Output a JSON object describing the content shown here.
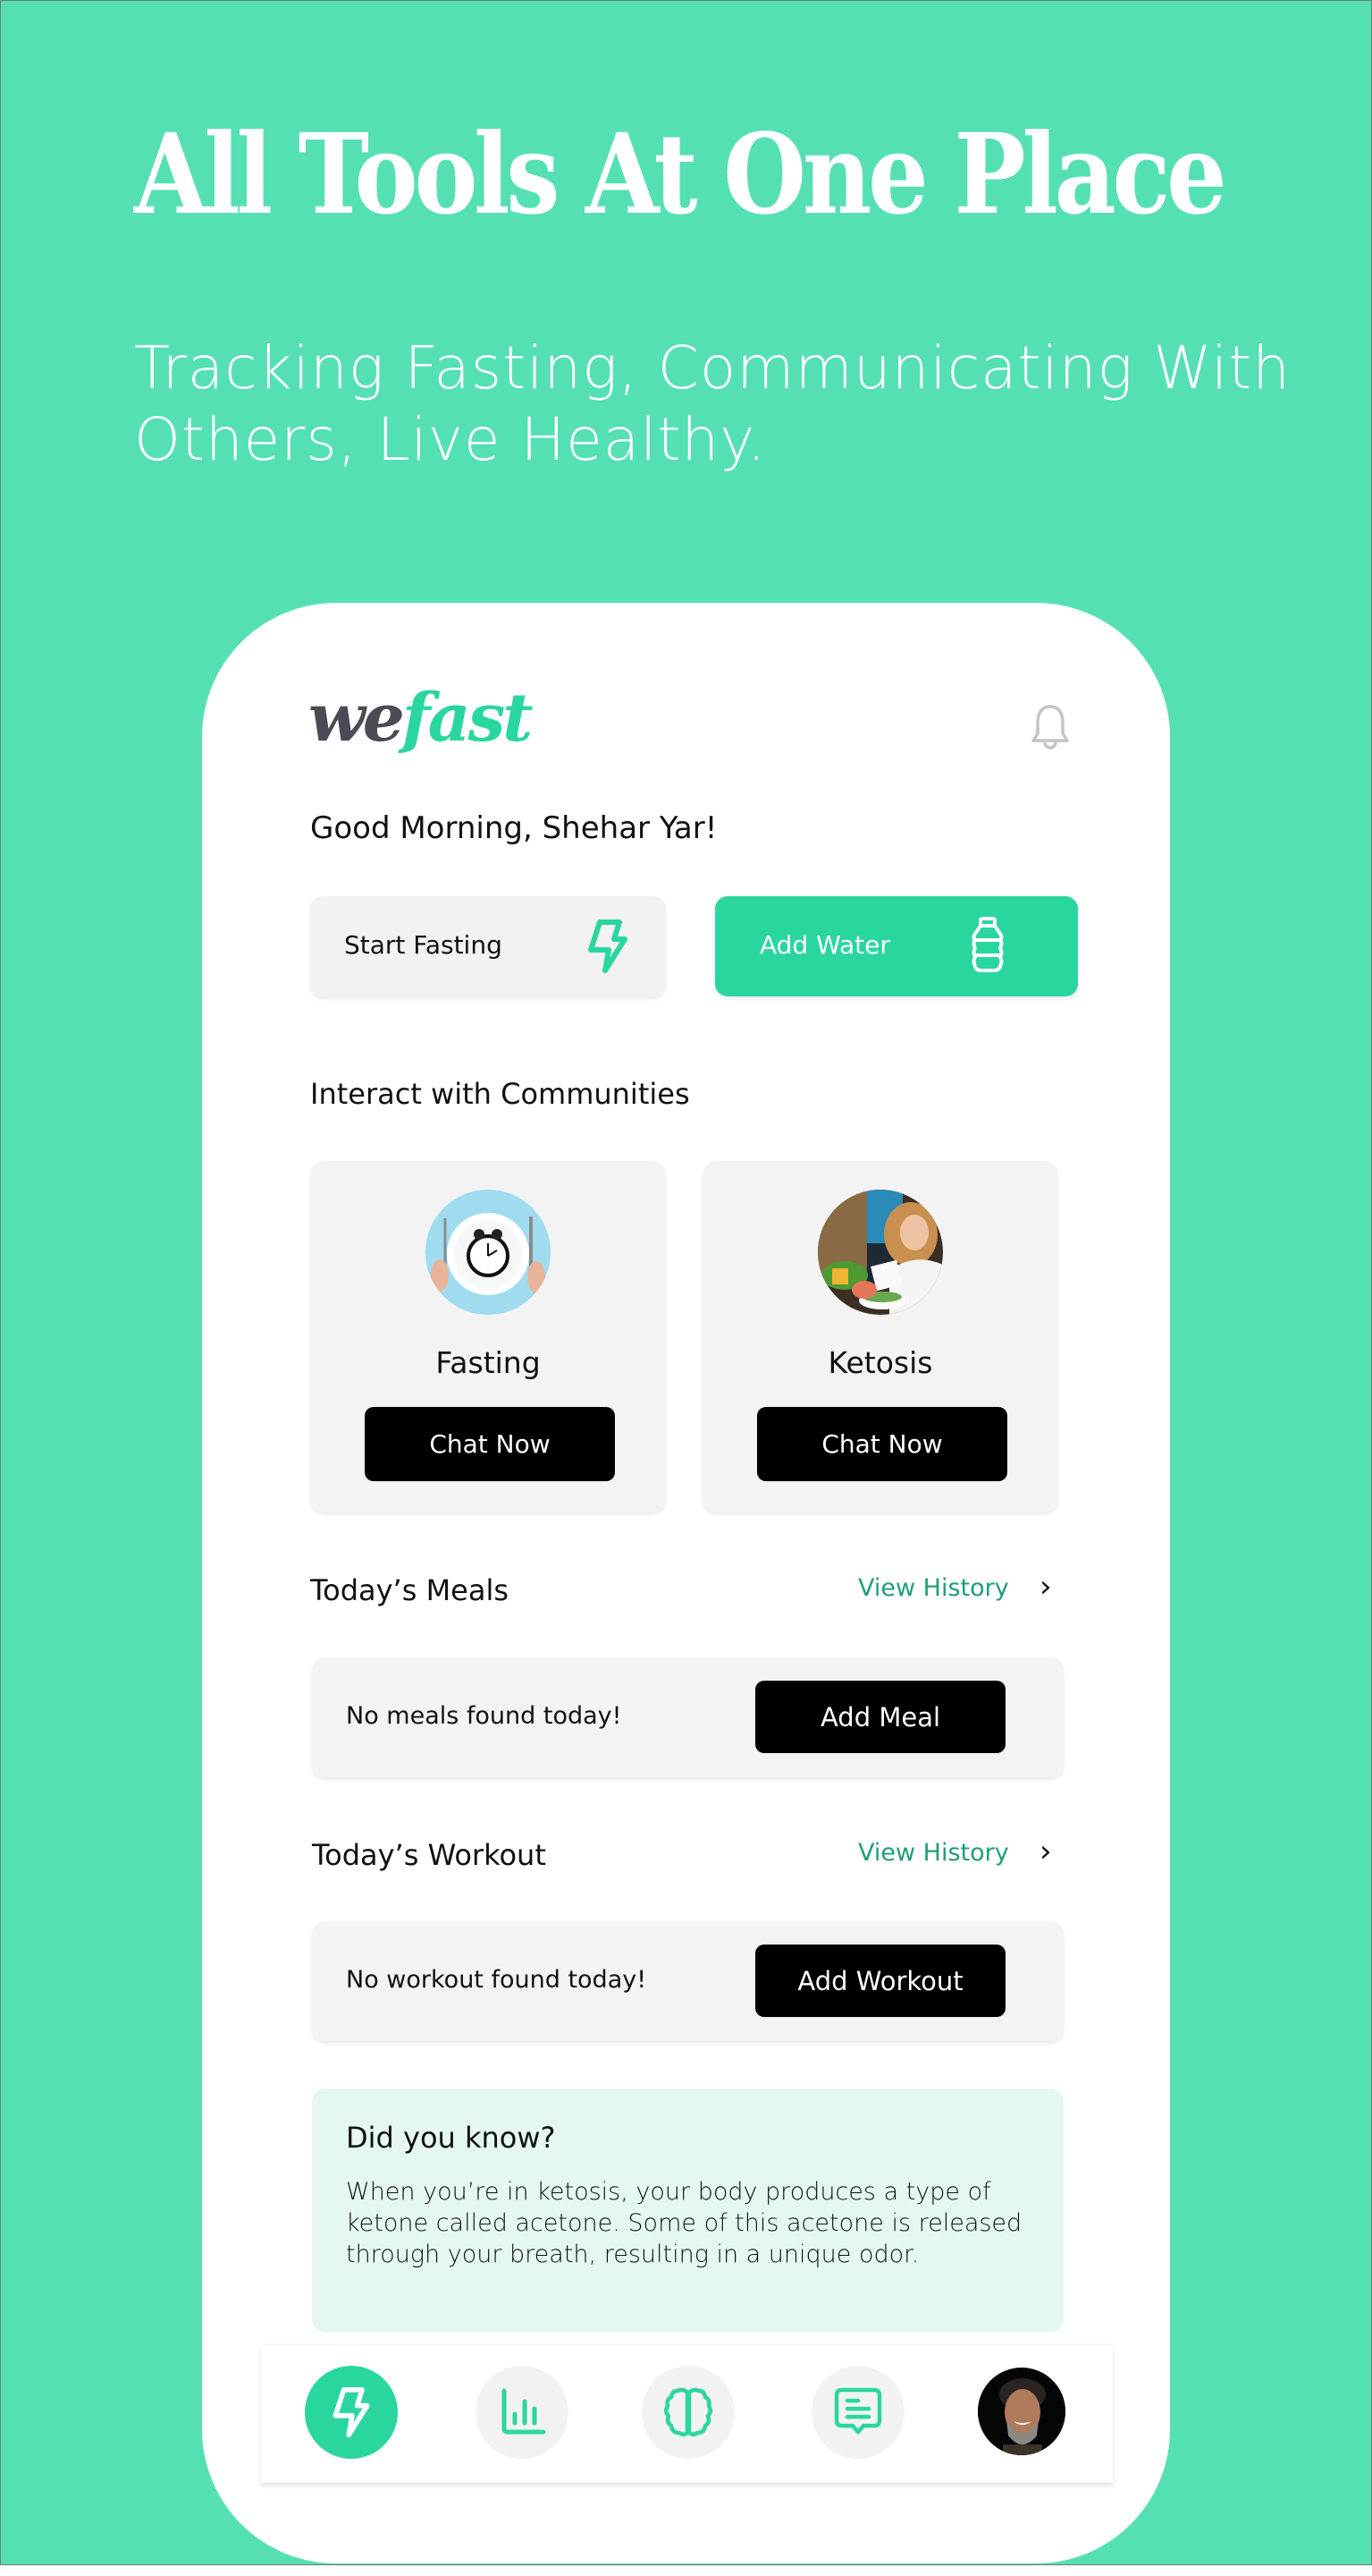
{
  "promo": {
    "headline": "All Tools At One Place",
    "subline": "Tracking Fasting, Communicating With Others, Live Healthy."
  },
  "colors": {
    "background": "#55e0b4",
    "accent": "#2ad69f",
    "link": "#1f9e78",
    "logo_dark": "#4b4a55",
    "card": "#f3f3f3",
    "tip_card": "#e4f8f1"
  },
  "app": {
    "logo": {
      "part1": "we",
      "part2": "fast"
    },
    "header": {
      "notification_icon": "bell-icon"
    },
    "greeting": "Good Morning, Shehar Yar!",
    "quick_actions": [
      {
        "label": "Start Fasting",
        "icon": "lightning-bolt-icon"
      },
      {
        "label": "Add Water",
        "icon": "water-bottle-icon"
      }
    ],
    "communities": {
      "title": "Interact with Communities",
      "items": [
        {
          "name": "Fasting",
          "image": "plate-with-alarm-clock",
          "button": "Chat Now"
        },
        {
          "name": "Ketosis",
          "image": "woman-with-salad",
          "button": "Chat Now"
        }
      ]
    },
    "meals": {
      "title": "Today’s Meals",
      "view_history": "View History",
      "empty_text": "No meals found today!",
      "button": "Add Meal"
    },
    "workout": {
      "title": "Today’s Workout",
      "view_history": "View History",
      "empty_text": "No workout found today!",
      "button": "Add Workout"
    },
    "did_you_know": {
      "title": "Did you know?",
      "body": "When you’re in ketosis, your body produces a type of ketone called acetone. Some of this acetone is released through your breath, resulting in a unique odor."
    },
    "bottom_nav": [
      {
        "name": "fasting",
        "icon": "lightning-bolt-icon",
        "active": true
      },
      {
        "name": "stats",
        "icon": "bar-chart-icon",
        "active": false
      },
      {
        "name": "mind",
        "icon": "brain-icon",
        "active": false
      },
      {
        "name": "chat",
        "icon": "chat-bubble-icon",
        "active": false
      },
      {
        "name": "profile",
        "icon": "profile-avatar",
        "active": false
      }
    ]
  }
}
